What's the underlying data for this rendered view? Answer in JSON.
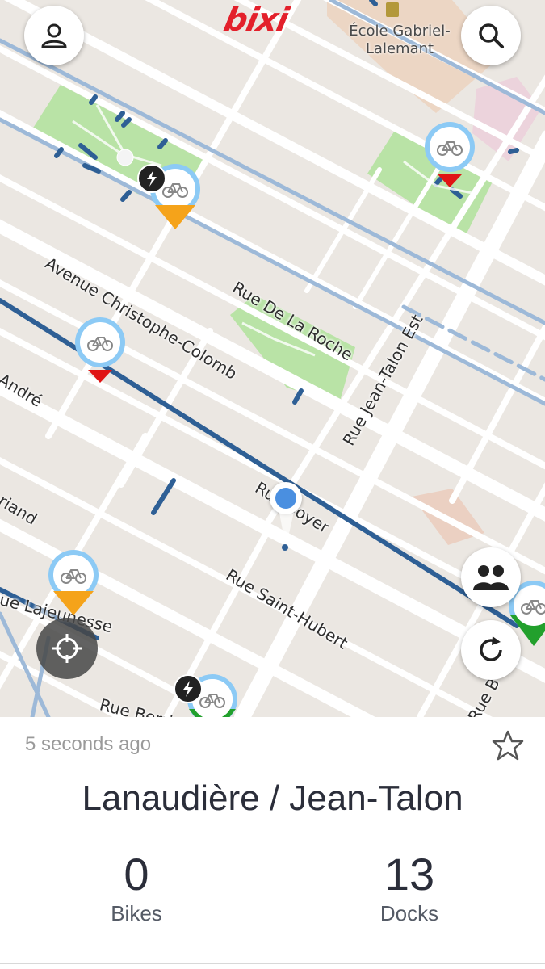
{
  "app": {
    "logo_text": "bixi"
  },
  "map": {
    "streets": [
      {
        "id": "christophe-colomb",
        "name": "Avenue Christophe-Colomb"
      },
      {
        "id": "de-la-roche",
        "name": "Rue De La Roche"
      },
      {
        "id": "jean-talon-est",
        "name": "Rue Jean-Talon Est"
      },
      {
        "id": "andre",
        "name": "André"
      },
      {
        "id": "boyer",
        "name": "Rue Boyer"
      },
      {
        "id": "briand",
        "name": "riand"
      },
      {
        "id": "saint-hubert",
        "name": "Rue Saint-Hubert"
      },
      {
        "id": "lajeunesse",
        "name": "ue Lajeunesse"
      },
      {
        "id": "berri",
        "name": "Rue Berri"
      },
      {
        "id": "b-edge",
        "name": "Rue B"
      }
    ],
    "poi": {
      "name_line1": "École Gabriel-",
      "name_line2": "Lalemant"
    },
    "colors": {
      "bike_lane": "#2e5f95",
      "park": "#b9e3a6",
      "marker_ring": "#8ccaf5",
      "tip_empty": "#e01414",
      "tip_low": "#f5a31a",
      "tip_good": "#22a02c"
    },
    "markers": [
      {
        "id": "m1",
        "status": "low",
        "electric": true
      },
      {
        "id": "m2",
        "status": "empty",
        "electric": false
      },
      {
        "id": "m3",
        "status": "empty",
        "electric": false
      },
      {
        "id": "m4",
        "status": "low",
        "electric": false
      },
      {
        "id": "m5",
        "status": "good",
        "electric": true
      },
      {
        "id": "m6",
        "status": "good",
        "electric": true
      }
    ]
  },
  "controls": {
    "profile_icon": "person-icon",
    "search_icon": "search-icon",
    "nearby_icon": "group-icon",
    "refresh_icon": "refresh-icon",
    "locate_icon": "crosshair-icon"
  },
  "station": {
    "updated": "5 seconds ago",
    "name": "Lanaudière / Jean-Talon",
    "bikes_count": "0",
    "bikes_label": "Bikes",
    "docks_count": "13",
    "docks_label": "Docks",
    "favorite_icon": "star-outline-icon"
  }
}
